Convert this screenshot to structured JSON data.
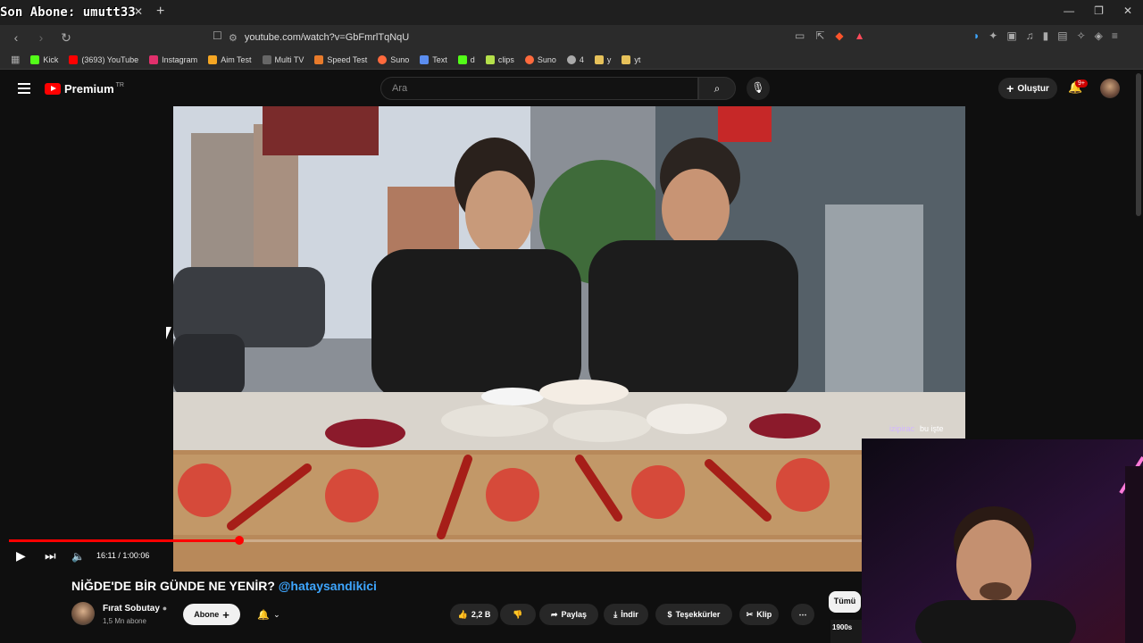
{
  "overlay": {
    "stream_title": "Son Abone: umutt33"
  },
  "browser": {
    "tab_close": "✕",
    "new_tab": "+",
    "url": "youtube.com/watch?v=GbFmrlTqNqU",
    "bookmarks": [
      {
        "label": "Kick",
        "color": "#53fc18"
      },
      {
        "label": "(3693) YouTube",
        "color": "#ff0000"
      },
      {
        "label": "Instagram",
        "color": "#e1306c"
      },
      {
        "label": "Aim Test",
        "color": "#f5a623"
      },
      {
        "label": "Multi TV",
        "color": "#666666"
      },
      {
        "label": "Speed Test",
        "color": "#e87b2b"
      },
      {
        "label": "Suno",
        "color": "#ff6a3d"
      },
      {
        "label": "Text",
        "color": "#5b8def"
      },
      {
        "label": "d",
        "color": "#53fc18"
      },
      {
        "label": "clips",
        "color": "#b4e04a"
      },
      {
        "label": "Suno",
        "color": "#ff6a3d"
      },
      {
        "label": "4",
        "color": "#aaaaaa"
      },
      {
        "label": "y",
        "color": "#e6c15a"
      },
      {
        "label": "yt",
        "color": "#e6c15a"
      }
    ]
  },
  "yt": {
    "logo_text": "Premium",
    "logo_region": "TR",
    "search_placeholder": "Ara",
    "create_label": "Oluştur",
    "notif_badge": "9+"
  },
  "player": {
    "current_time": "16:11",
    "duration": "1:00:06",
    "time_display": "16:11 / 1:00:06",
    "progress": 0.27,
    "watermark_user": "izipirac",
    "watermark_text": "bu işte"
  },
  "video_info": {
    "title": "NİĞDE'DE BİR GÜNDE NE YENİR?",
    "title_handle": "@hataysandikici",
    "channel_name": "Fırat Sobutay",
    "subscribers": "1,5 Mn abone",
    "subscribe_label": "Abone",
    "likes": "2,2 B",
    "share_label": "Paylaş",
    "download_label": "İndir",
    "thanks_label": "Teşekkürler",
    "clip_label": "Klip",
    "more_label": "⋯",
    "filter_all": "Tümü",
    "peek_text": "1900s"
  },
  "colors": {
    "accent": "#ff0000",
    "link": "#3ea6ff",
    "bg": "#0f0f0f"
  }
}
